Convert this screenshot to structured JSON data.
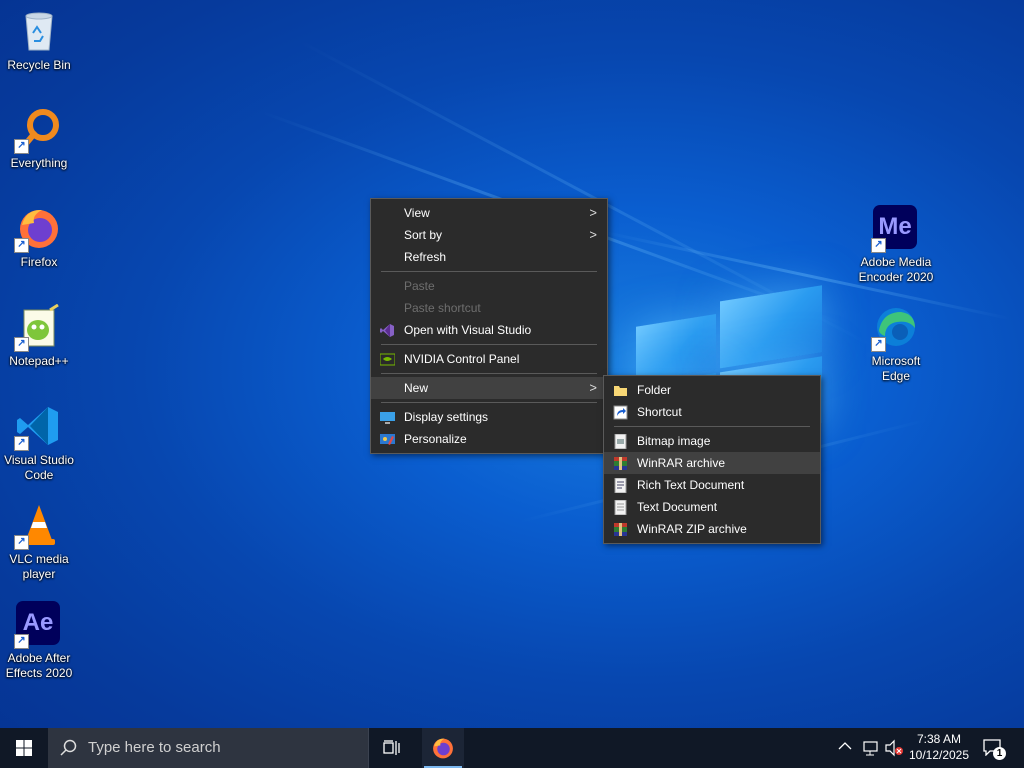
{
  "desktop_icons": {
    "recycle_bin": "Recycle Bin",
    "everything": "Everything",
    "firefox": "Firefox",
    "notepadpp": "Notepad++",
    "vscode": "Visual Studio Code",
    "vlc": "VLC media player",
    "after_effects": "Adobe After Effects 2020",
    "media_encoder": "Adobe Media Encoder 2020",
    "edge": "Microsoft Edge"
  },
  "icon_glyphs": {
    "media_encoder": "Me",
    "after_effects": "Ae"
  },
  "context_menu": {
    "view": "View",
    "sort_by": "Sort by",
    "refresh": "Refresh",
    "paste": "Paste",
    "paste_shortcut": "Paste shortcut",
    "open_vs": "Open with Visual Studio",
    "nvidia": "NVIDIA Control Panel",
    "new": "New",
    "display_settings": "Display settings",
    "personalize": "Personalize"
  },
  "new_submenu": {
    "folder": "Folder",
    "shortcut": "Shortcut",
    "bitmap": "Bitmap image",
    "winrar": "WinRAR archive",
    "rtf": "Rich Text Document",
    "text": "Text Document",
    "winrar_zip": "WinRAR ZIP archive"
  },
  "taskbar": {
    "search_placeholder": "Type here to search",
    "time": "7:38 AM",
    "date": "10/12/2025",
    "notification_count": "1"
  },
  "colors": {
    "accent": "#0a5ed0",
    "menu_bg": "#2b2b2b",
    "taskbar_bg": "#101826"
  }
}
